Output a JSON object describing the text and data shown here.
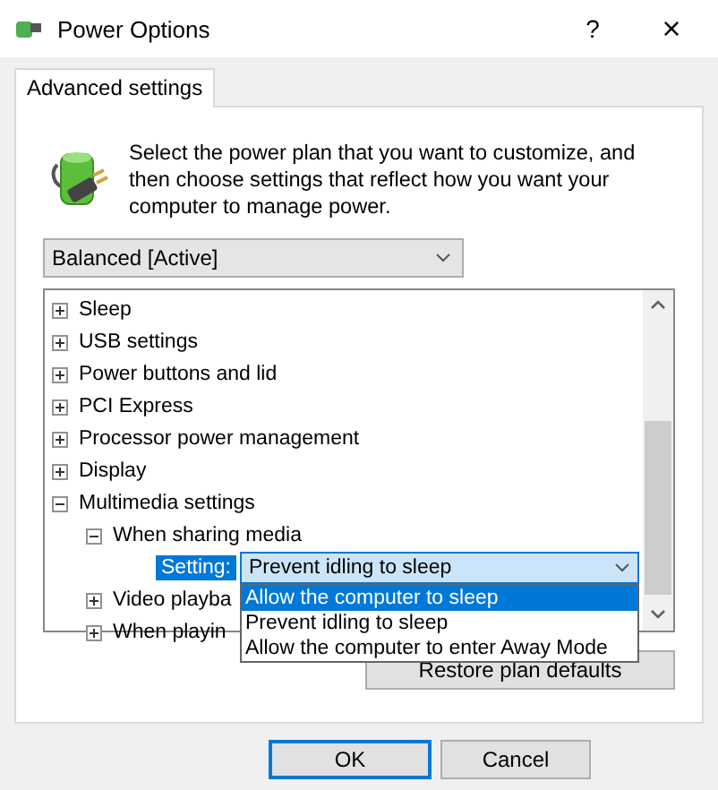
{
  "window": {
    "title": "Power Options",
    "help": "?",
    "close": "×"
  },
  "tabs": [
    {
      "label": "Advanced settings",
      "selected": true
    }
  ],
  "intro": "Select the power plan that you want to customize, and then choose settings that reflect how you want your computer to manage power.",
  "plan_select": {
    "value": "Balanced [Active]"
  },
  "tree": {
    "items": [
      {
        "label": "Sleep",
        "expanded": false
      },
      {
        "label": "USB settings",
        "expanded": false
      },
      {
        "label": "Power buttons and lid",
        "expanded": false
      },
      {
        "label": "PCI Express",
        "expanded": false
      },
      {
        "label": "Processor power management",
        "expanded": false
      },
      {
        "label": "Display",
        "expanded": false
      },
      {
        "label": "Multimedia settings",
        "expanded": true,
        "children": [
          {
            "label": "When sharing media",
            "expanded": true,
            "children": [
              {
                "kind": "setting",
                "label": "Setting:",
                "value": "Prevent idling to sleep",
                "selected": true,
                "open": true,
                "options": [
                  {
                    "label": "Allow the computer to sleep",
                    "highlighted": true
                  },
                  {
                    "label": "Prevent idling to sleep",
                    "highlighted": false
                  },
                  {
                    "label": "Allow the computer to enter Away Mode",
                    "highlighted": false
                  }
                ]
              }
            ]
          },
          {
            "label": "Video playba",
            "expanded": false
          },
          {
            "label": "When playin",
            "expanded": false
          }
        ]
      }
    ]
  },
  "restore_button": "Restore plan defaults",
  "buttons": [
    "OK",
    "Cancel"
  ]
}
